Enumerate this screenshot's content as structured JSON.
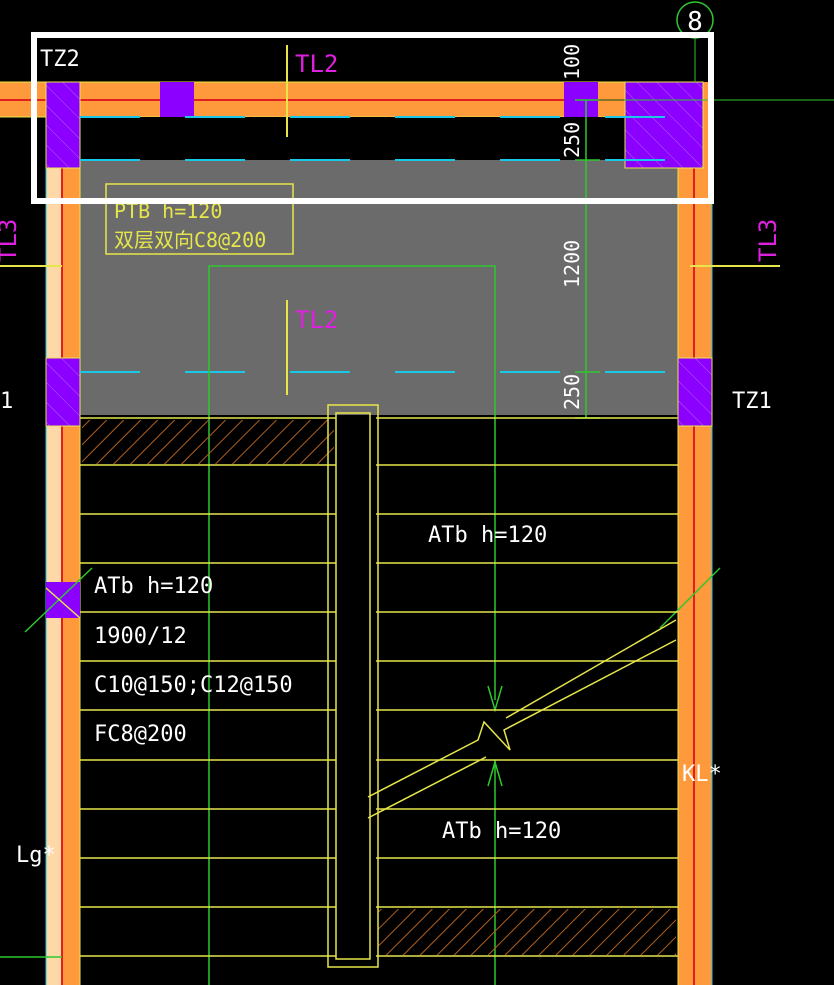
{
  "drawing": {
    "labels": {
      "tz2": "TZ2",
      "tz1": "TZ1",
      "tl2_top": "TL2",
      "tl2_mid": "TL2",
      "tl3_right": "TL3",
      "tl3_left": "TL3",
      "grid_axis": "8",
      "ptb_line1": "PTB  h=120",
      "ptb_line2": "双层双向C8@200",
      "dim_100": "100",
      "dim_250_top": "250",
      "dim_1200": "1200",
      "dim_250_bottom": "250",
      "atb_right_upper": "ATb  h=120",
      "atb_left_line1": "ATb  h=120",
      "atb_left_line2": "1900/12",
      "atb_left_line3": "C10@150;C12@150",
      "atb_left_line4": "FC8@200",
      "atb_right_lower": "ATb  h=120",
      "kl": "KL*",
      "lg": "Lg*",
      "left_edge_1": "1"
    },
    "colors": {
      "background": "#000000",
      "beam_orange": "#ff9a3c",
      "column_purple": "#8b00ff",
      "slab_gray": "#6b6b6b",
      "yellow": "#e6e64a",
      "cyan": "#19c8e6",
      "green": "#2ec82e",
      "magenta": "#e020e0",
      "red": "#e02020",
      "white": "#ffffff",
      "hatch": "#b0601e",
      "peach": "#ffd8a8"
    }
  }
}
